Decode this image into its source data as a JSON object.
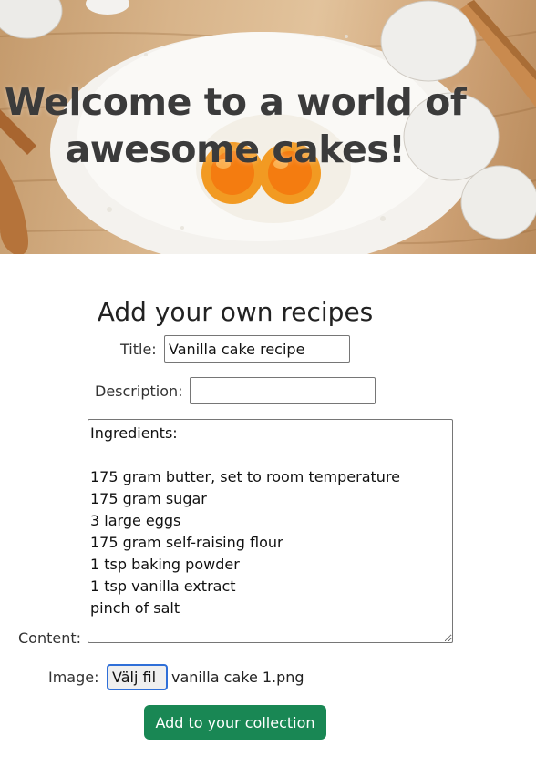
{
  "hero": {
    "title_line1": "Welcome to a world of",
    "title_line2": "awesome cakes!"
  },
  "form": {
    "heading": "Add your own recipes",
    "title_label": "Title:",
    "title_value": "Vanilla cake recipe",
    "description_label": "Description:",
    "description_value": "",
    "content_label": "Content:",
    "content_value": "Ingredients:\n\n175 gram butter, set to room temperature\n175 gram sugar\n3 large eggs\n175 gram self-raising flour\n1 tsp baking powder\n1 tsp vanilla extract\npinch of salt",
    "image_label": "Image:",
    "file_button_label": "Välj fil",
    "file_name": "vanilla cake 1.png",
    "submit_label": "Add to your collection"
  },
  "colors": {
    "submit_button": "#198754",
    "file_button_focus": "#2f6fd8"
  }
}
